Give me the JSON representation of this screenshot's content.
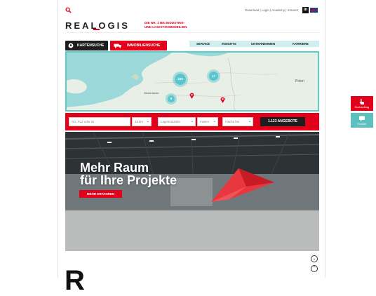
{
  "header": {
    "toplinks": "Download | Login | Academy | Intranet",
    "linkedin_label": "in",
    "logo": "REALOGIS",
    "tagline_line1": "DIE NR. 1 BEI INDUSTRIE-",
    "tagline_line2": "UND LOGISTIKIMMOBILIEN"
  },
  "tabs": {
    "map_search": "KARTENSUCHE",
    "property_search": "IMMOBILIENSUCHE"
  },
  "nav": {
    "items": [
      "SERVICE",
      "INSIGHTS",
      "UNTERNEHMEN",
      "KARRIERE"
    ]
  },
  "map": {
    "clusters": [
      "193",
      "17",
      "6"
    ],
    "label_poland": "Polen",
    "label_netherlands": "Niederlande"
  },
  "search": {
    "location_placeholder": "Ort, PLZ oder ID",
    "radius": "25 km",
    "location_type": "Lage/Industrie",
    "rent_or_buy": "mieten",
    "area": "Fläche bis",
    "offers_button": "1.123 ANGEBOTE"
  },
  "hero": {
    "title_line1": "Mehr Raum",
    "title_line2": "für Ihre Projekte",
    "button": "MEHR ERFAHREN"
  },
  "side": {
    "search_label": "Suchauftrag",
    "contact_label": "Kontakt"
  },
  "colors": {
    "brand_red": "#e2001a",
    "accent_teal": "#5bc5cf",
    "dark": "#1e1e1e"
  }
}
